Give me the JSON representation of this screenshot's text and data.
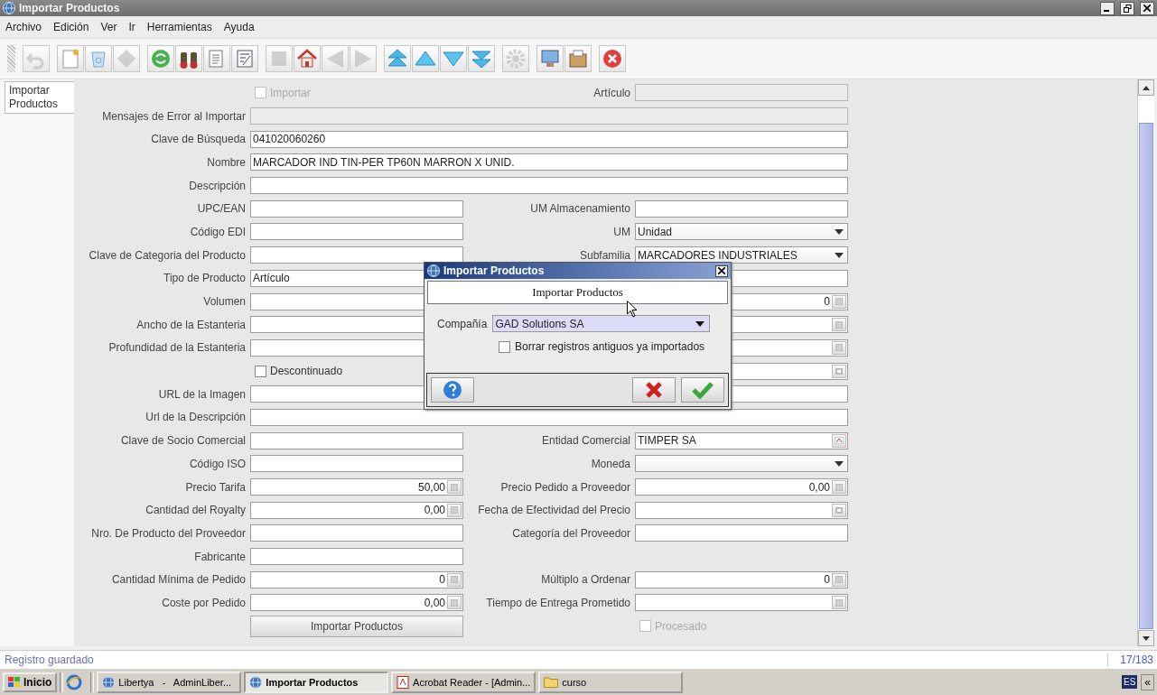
{
  "window": {
    "title": "Importar Productos"
  },
  "menu": [
    {
      "label": "Archivo"
    },
    {
      "label": "Edición"
    },
    {
      "label": "Ver"
    },
    {
      "label": "Ir"
    },
    {
      "label": "Herramientas"
    },
    {
      "label": "Ayuda"
    }
  ],
  "toolbar": [
    [
      {
        "disabled": true
      }
    ],
    [
      {
        "disabled": false
      },
      {
        "disabled": false
      },
      {
        "disabled": true
      }
    ],
    [
      {
        "disabled": false
      },
      {
        "disabled": false
      },
      {
        "disabled": false
      },
      {
        "disabled": false
      }
    ],
    [
      {
        "disabled": true
      },
      {
        "disabled": false
      },
      {
        "disabled": true
      },
      {
        "disabled": true
      }
    ],
    [
      {
        "disabled": false
      },
      {
        "disabled": false
      },
      {
        "disabled": false
      },
      {
        "disabled": false
      }
    ],
    [
      {
        "disabled": true
      }
    ],
    [
      {
        "disabled": false
      },
      {
        "disabled": false
      }
    ],
    [
      {
        "disabled": false
      }
    ]
  ],
  "tabs": [
    {
      "label": "Importar Productos",
      "selected": true
    }
  ],
  "form": {
    "rows": [
      {
        "left": {
          "kind": "check",
          "label": "Importar",
          "checked": false,
          "disabled": true
        },
        "right": {
          "kind": "text",
          "label": "Artículo",
          "disabled": true
        }
      },
      {
        "full": true,
        "left": {
          "kind": "text",
          "label": "Mensajes de Error al Importar",
          "disabled": true
        }
      },
      {
        "full": true,
        "left": {
          "kind": "text",
          "label": "Clave de Búsqueda",
          "value": "041020060260",
          "disabled": false
        }
      },
      {
        "full": true,
        "left": {
          "kind": "text",
          "label": "Nombre",
          "value": "MARCADOR IND TIN-PER TP60N MARRON X UNID.",
          "disabled": false
        }
      },
      {
        "full": true,
        "left": {
          "kind": "text",
          "label": "Descripción",
          "disabled": false
        }
      },
      {
        "left": {
          "kind": "text",
          "label": "UPC/EAN",
          "disabled": false
        },
        "right": {
          "kind": "text",
          "label": "UM Almacenamiento",
          "disabled": false
        }
      },
      {
        "left": {
          "kind": "text",
          "label": "Código EDI",
          "disabled": false
        },
        "right": {
          "kind": "combo",
          "label": "UM",
          "value": "Unidad",
          "disabled": false
        }
      },
      {
        "left": {
          "kind": "text",
          "label": "Clave de Categoria del Producto",
          "disabled": false
        },
        "right": {
          "kind": "combo",
          "label": "Subfamilia",
          "value": "MARCADORES INDUSTRIALES",
          "disabled": false
        }
      },
      {
        "left": {
          "kind": "text",
          "label": "Tipo de Producto",
          "value": "Artículo",
          "disabled": false
        },
        "right": {
          "kind": "text",
          "disabled": false
        }
      },
      {
        "left": {
          "kind": "text",
          "label": "Volumen",
          "disabled": false
        },
        "right": {
          "kind": "number",
          "value": "0",
          "disabled": false
        }
      },
      {
        "left": {
          "kind": "text",
          "label": "Ancho de la Estanteria",
          "disabled": false
        },
        "right": {
          "kind": "number",
          "disabled": false
        }
      },
      {
        "left": {
          "kind": "text",
          "label": "Profundidad de la Estanteria",
          "disabled": false
        },
        "right": {
          "kind": "number",
          "disabled": false
        }
      },
      {
        "left": {
          "kind": "check",
          "label": "Descontinuado",
          "checked": false,
          "disabled": false
        },
        "right": {
          "kind": "date",
          "disabled": false
        }
      },
      {
        "full": true,
        "left": {
          "kind": "text",
          "label": "URL de la Imagen",
          "disabled": false
        }
      },
      {
        "full": true,
        "left": {
          "kind": "text",
          "label": "Url de la Descripción",
          "disabled": false
        }
      },
      {
        "left": {
          "kind": "text",
          "label": "Clave de Socio Comercial",
          "disabled": false
        },
        "right": {
          "kind": "search",
          "label": "Entidad Comercial",
          "value": "TIMPER SA",
          "disabled": false
        }
      },
      {
        "left": {
          "kind": "text",
          "label": "Código ISO",
          "disabled": false
        },
        "right": {
          "kind": "combo",
          "label": "Moneda",
          "disabled": false
        }
      },
      {
        "left": {
          "kind": "number",
          "label": "Precio Tarifa",
          "value": "50,00",
          "disabled": false
        },
        "right": {
          "kind": "number",
          "label": "Precio Pedido a Proveedor",
          "value": "0,00",
          "disabled": false
        }
      },
      {
        "left": {
          "kind": "number",
          "label": "Cantidad del Royalty",
          "value": "0,00",
          "disabled": false
        },
        "right": {
          "kind": "date",
          "label": "Fecha de Efectividad del Precio",
          "disabled": false
        }
      },
      {
        "left": {
          "kind": "text",
          "label": "Nro. De Producto del Proveedor",
          "disabled": false
        },
        "right": {
          "kind": "text",
          "label": "Categoría del Proveedor",
          "disabled": false
        }
      },
      {
        "left": {
          "kind": "text",
          "label": "Fabricante",
          "disabled": false
        }
      },
      {
        "left": {
          "kind": "number",
          "label": "Cantidad Mínima de Pedido",
          "value": "0",
          "disabled": false
        },
        "right": {
          "kind": "number",
          "label": "Múltiplo a Ordenar",
          "value": "0",
          "disabled": false
        }
      },
      {
        "left": {
          "kind": "number",
          "label": "Coste por Pedido",
          "value": "0,00",
          "disabled": false
        },
        "right": {
          "kind": "number",
          "label": "Tiempo de Entrega Prometido",
          "disabled": false
        }
      },
      {
        "left": {
          "kind": "button",
          "label": "Importar Productos"
        },
        "right": {
          "kind": "check",
          "label": "Procesado",
          "checked": false,
          "disabled": true
        }
      }
    ]
  },
  "dialog": {
    "title": "Importar Productos",
    "header": "Importar Productos",
    "company_label": "Compañía",
    "company_value": "GAD Solutions SA",
    "checkbox": {
      "label": "Borrar registros antiguos ya importados",
      "checked": false
    }
  },
  "status_bar": {
    "message": "Registro guardado",
    "record": "17/183"
  },
  "taskbar": {
    "start": "Inicio",
    "tasks": [
      {
        "label": "Libertya   -   AdminLiber...",
        "kind": "app",
        "selected": false
      },
      {
        "label": "Importar Productos",
        "kind": "app",
        "selected": true
      },
      {
        "label": "Acrobat Reader - [Admin...",
        "kind": "pdf",
        "selected": false
      },
      {
        "label": "curso",
        "kind": "folder",
        "selected": false
      }
    ],
    "language": "ES",
    "expand": "«"
  }
}
